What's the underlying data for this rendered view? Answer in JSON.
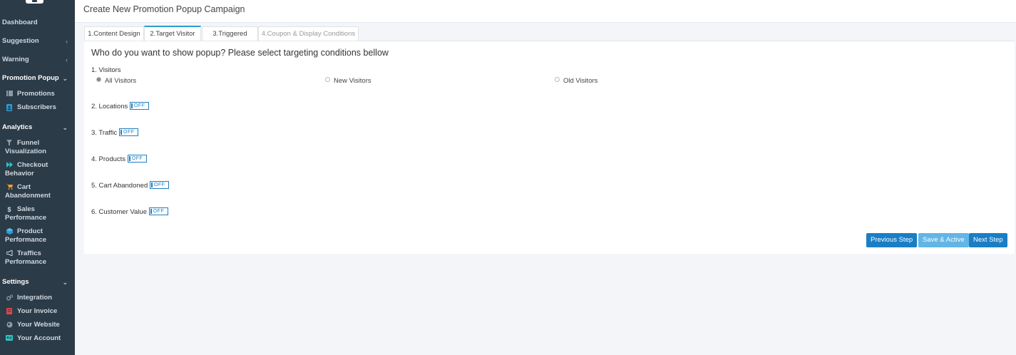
{
  "colors": {
    "sidebar_bg": "#2c3b48",
    "accent": "#2a9cd3",
    "button_primary": "#1a7ec6",
    "button_disabled": "#62b5e5"
  },
  "sidebar": {
    "items": [
      {
        "label": "Dashboard"
      },
      {
        "label": "Suggestion",
        "chevron": "‹"
      },
      {
        "label": "Warning",
        "chevron": "‹"
      },
      {
        "label": "Promotion Popup",
        "chevron": "⌄"
      }
    ],
    "promotion_sub": [
      {
        "label": "Promotions",
        "icon": "list-icon"
      },
      {
        "label": "Subscribers",
        "icon": "user-icon"
      }
    ],
    "analytics": {
      "label": "Analytics",
      "chevron": "⌄"
    },
    "analytics_sub": [
      {
        "line1": "Funnel",
        "line2": "Visualization",
        "icon": "funnel-icon"
      },
      {
        "line1": "Checkout",
        "line2": "Behavior",
        "icon": "fast-forward-icon"
      },
      {
        "line1": "Cart",
        "line2": "Abandonment",
        "icon": "cart-icon"
      },
      {
        "line1": "Sales",
        "line2": "Performance",
        "icon": "dollar-icon"
      },
      {
        "line1": "Product",
        "line2": "Performance",
        "icon": "cube-icon"
      },
      {
        "line1": "Traffics",
        "line2": "Performance",
        "icon": "megaphone-icon"
      }
    ],
    "settings": {
      "label": "Settings",
      "chevron": "⌄"
    },
    "settings_sub": [
      {
        "label": "Integration",
        "icon": "gears-icon"
      },
      {
        "label": "Your Invoice",
        "icon": "invoice-icon"
      },
      {
        "label": "Your Website",
        "icon": "globe-icon"
      },
      {
        "label": "Your Account",
        "icon": "id-card-icon"
      }
    ]
  },
  "header": {
    "title": "Create New Promotion Popup Campaign"
  },
  "tabs": [
    {
      "label": "1.Content Design"
    },
    {
      "label": "2.Target Visitor",
      "active": true
    },
    {
      "label": "3.Triggered"
    },
    {
      "label": "4.Coupon & Display Conditions",
      "disabled": true
    }
  ],
  "main": {
    "question": "Who do you want to show popup? Please select targeting conditions bellow",
    "visitors": {
      "title": "1. Visitors",
      "options": [
        "All Visitors",
        "New Visitors",
        "Old Visitors"
      ],
      "selected": "All Visitors"
    },
    "sections": [
      {
        "title": "2. Locations",
        "toggle": "OFF"
      },
      {
        "title": "3. Traffic",
        "toggle": "OFF"
      },
      {
        "title": "4. Products",
        "toggle": "OFF"
      },
      {
        "title": "5. Cart Abandoned",
        "toggle": "OFF"
      },
      {
        "title": "6. Customer Value",
        "toggle": "OFF"
      }
    ],
    "buttons": {
      "previous": "Previous Step",
      "save": "Save & Active",
      "next": "Next Step"
    }
  }
}
